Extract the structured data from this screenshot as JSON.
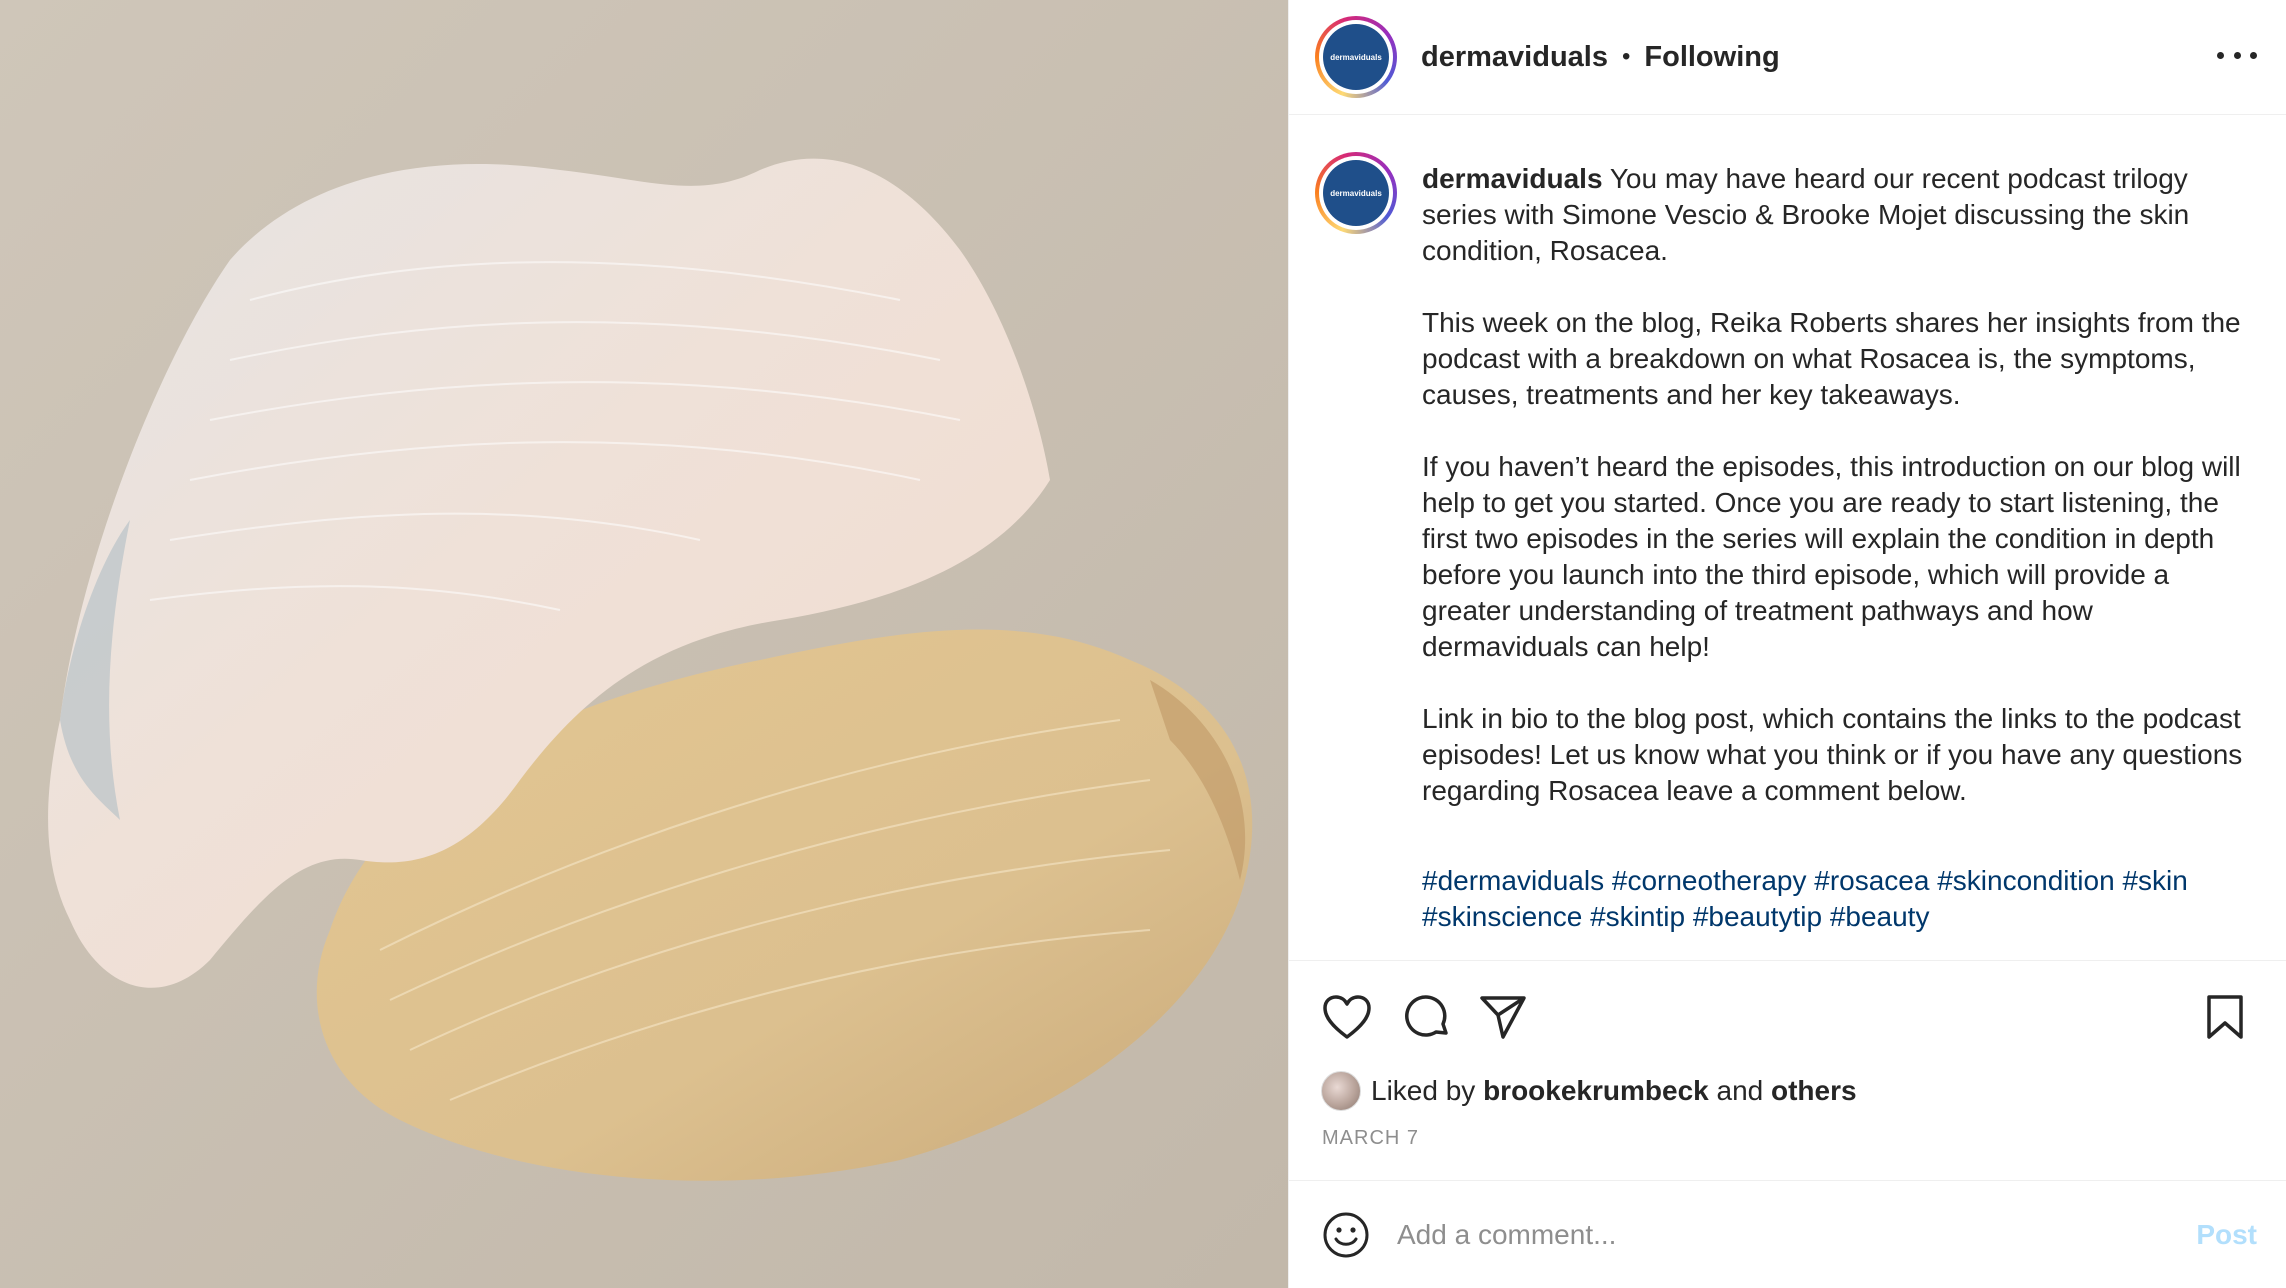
{
  "post": {
    "account": "dermaviduals",
    "avatar_text": "dermaviduals",
    "follow_status": "Following",
    "separator": "•"
  },
  "caption": {
    "username": "dermaviduals",
    "paragraphs": [
      "You may have heard our recent podcast trilogy series with Simone Vescio & Brooke Mojet discussing the skin condition, Rosacea.",
      "This week on the blog, Reika Roberts shares her insights from the podcast with a breakdown on what Rosacea is, the symptoms, causes, treatments and her key takeaways.",
      "If you haven’t heard the episodes, this introduction on our blog will help to get you started. Once you are ready to start listening, the first two episodes in the series will explain the condition in depth before you launch into the third episode, which will provide a greater understanding of treatment pathways and how dermaviduals can help!",
      "Link in bio to the blog post, which contains the links to the podcast episodes! Let us know what you think or if you have any questions regarding Rosacea leave a comment below."
    ],
    "hashtags": [
      "#dermaviduals",
      "#corneotherapy",
      "#rosacea",
      "#skincondition",
      "#skin",
      "#skinscience",
      "#skintip",
      "#beautytip",
      "#beauty"
    ]
  },
  "actions": {
    "icons": [
      "heart-icon",
      "comment-icon",
      "share-icon",
      "bookmark-icon"
    ],
    "liked_prefix": "Liked by",
    "liked_user": "brookekrumbeck",
    "liked_and": "and",
    "liked_others": "others",
    "date": "MARCH 7"
  },
  "comment": {
    "placeholder": "Add a comment...",
    "post_label": "Post",
    "emoji_icon": "smiley-icon"
  },
  "colors": {
    "link": "#00376b",
    "post_disabled": "#b2dffc",
    "avatar_bg": "#1f4f8a",
    "muted": "#8e8e8e"
  }
}
